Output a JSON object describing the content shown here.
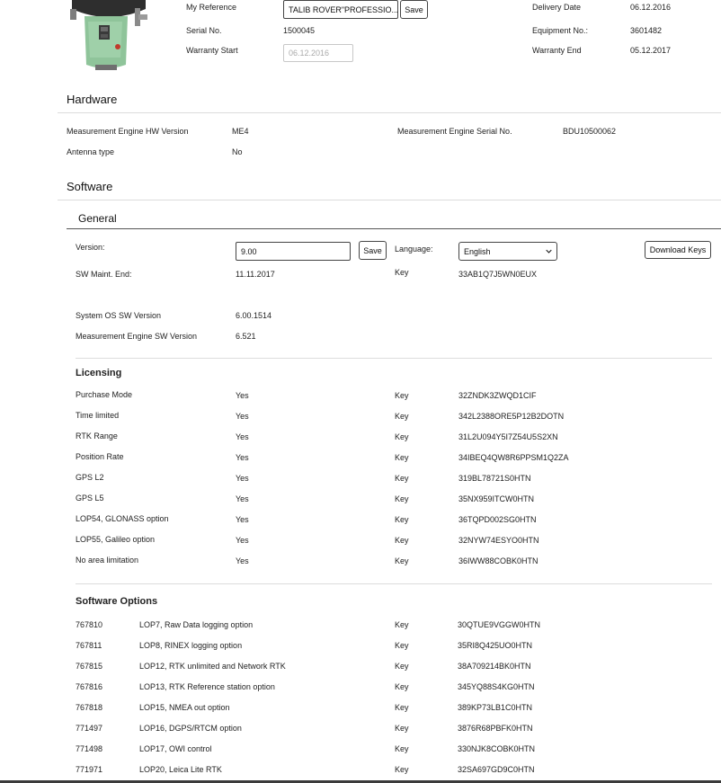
{
  "device": {
    "my_reference_label": "My Reference",
    "my_reference_value": "TALIB ROVER\"PROFESSIO...",
    "save_label": "Save",
    "serial_label": "Serial No.",
    "serial_value": "1500045",
    "warranty_start_label": "Warranty Start",
    "warranty_start_value": "06.12.2016",
    "delivery_label": "Delivery Date",
    "delivery_value": "06.12.2016",
    "equipment_label": "Equipment No.:",
    "equipment_value": "3601482",
    "warranty_end_label": "Warranty End",
    "warranty_end_value": "05.12.2017"
  },
  "hardware": {
    "title": "Hardware",
    "hw_version_label": "Measurement Engine HW Version",
    "hw_version_value": "ME4",
    "me_serial_label": "Measurement Engine Serial No.",
    "me_serial_value": "BDU10500062",
    "antenna_label": "Antenna type",
    "antenna_value": "No"
  },
  "software": {
    "title": "Software",
    "general_title": "General",
    "version_label": "Version:",
    "version_value": "9.00",
    "save_label": "Save",
    "language_label": "Language:",
    "language_value": "English",
    "download_keys_label": "Download Keys",
    "sw_maint_label": "SW Maint. End:",
    "sw_maint_value": "11.11.2017",
    "key_label": "Key",
    "sw_maint_key": "33AB1Q7J5WN0EUX",
    "os_label": "System OS SW Version",
    "os_value": "6.00.1514",
    "me_sw_label": "Measurement Engine SW Version",
    "me_sw_value": "6.521"
  },
  "licensing": {
    "title": "Licensing",
    "rows": [
      {
        "name": "Purchase Mode",
        "value": "Yes",
        "key_label": "Key",
        "key": "32ZNDK3ZWQD1CIF"
      },
      {
        "name": "Time limited",
        "value": "Yes",
        "key_label": "Key",
        "key": "342L2388ORE5P12B2DOTN"
      },
      {
        "name": "RTK Range",
        "value": "Yes",
        "key_label": "Key",
        "key": "31L2U094Y5I7Z54U5S2XN"
      },
      {
        "name": "Position Rate",
        "value": "Yes",
        "key_label": "Key",
        "key": "34IBEQ4QW8R6PPSM1Q2ZA"
      },
      {
        "name": "GPS L2",
        "value": "Yes",
        "key_label": "Key",
        "key": "319BL78721S0HTN"
      },
      {
        "name": "GPS L5",
        "value": "Yes",
        "key_label": "Key",
        "key": "35NX959ITCW0HTN"
      },
      {
        "name": "LOP54, GLONASS option",
        "value": "Yes",
        "key_label": "Key",
        "key": "36TQPD002SG0HTN"
      },
      {
        "name": "LOP55, Galileo option",
        "value": "Yes",
        "key_label": "Key",
        "key": "32NYW74ESYO0HTN"
      },
      {
        "name": "No area limitation",
        "value": "Yes",
        "key_label": "Key",
        "key": "36IWW88COBK0HTN"
      }
    ]
  },
  "options": {
    "title": "Software Options",
    "rows": [
      {
        "id": "767810",
        "name": "LOP7, Raw Data logging option",
        "key_label": "Key",
        "key": "30QTUE9VGGW0HTN"
      },
      {
        "id": "767811",
        "name": "LOP8, RINEX logging option",
        "key_label": "Key",
        "key": "35RI8Q425UO0HTN"
      },
      {
        "id": "767815",
        "name": "LOP12, RTK unlimited and Network RTK",
        "key_label": "Key",
        "key": "38A709214BK0HTN"
      },
      {
        "id": "767816",
        "name": "LOP13, RTK Reference station option",
        "key_label": "Key",
        "key": "345YQ88S4KG0HTN"
      },
      {
        "id": "767818",
        "name": "LOP15, NMEA out option",
        "key_label": "Key",
        "key": "389KP73LB1C0HTN"
      },
      {
        "id": "771497",
        "name": "LOP16, DGPS/RTCM option",
        "key_label": "Key",
        "key": "3876R68PBFK0HTN"
      },
      {
        "id": "771498",
        "name": "LOP17, OWI control",
        "key_label": "Key",
        "key": "330NJK8COBK0HTN"
      },
      {
        "id": "771971",
        "name": "LOP20, Leica Lite RTK",
        "key_label": "Key",
        "key": "32SA697GD9C0HTN"
      }
    ]
  },
  "colors": {
    "device_green": "#8fc49a",
    "device_dark": "#2e2e2e"
  }
}
